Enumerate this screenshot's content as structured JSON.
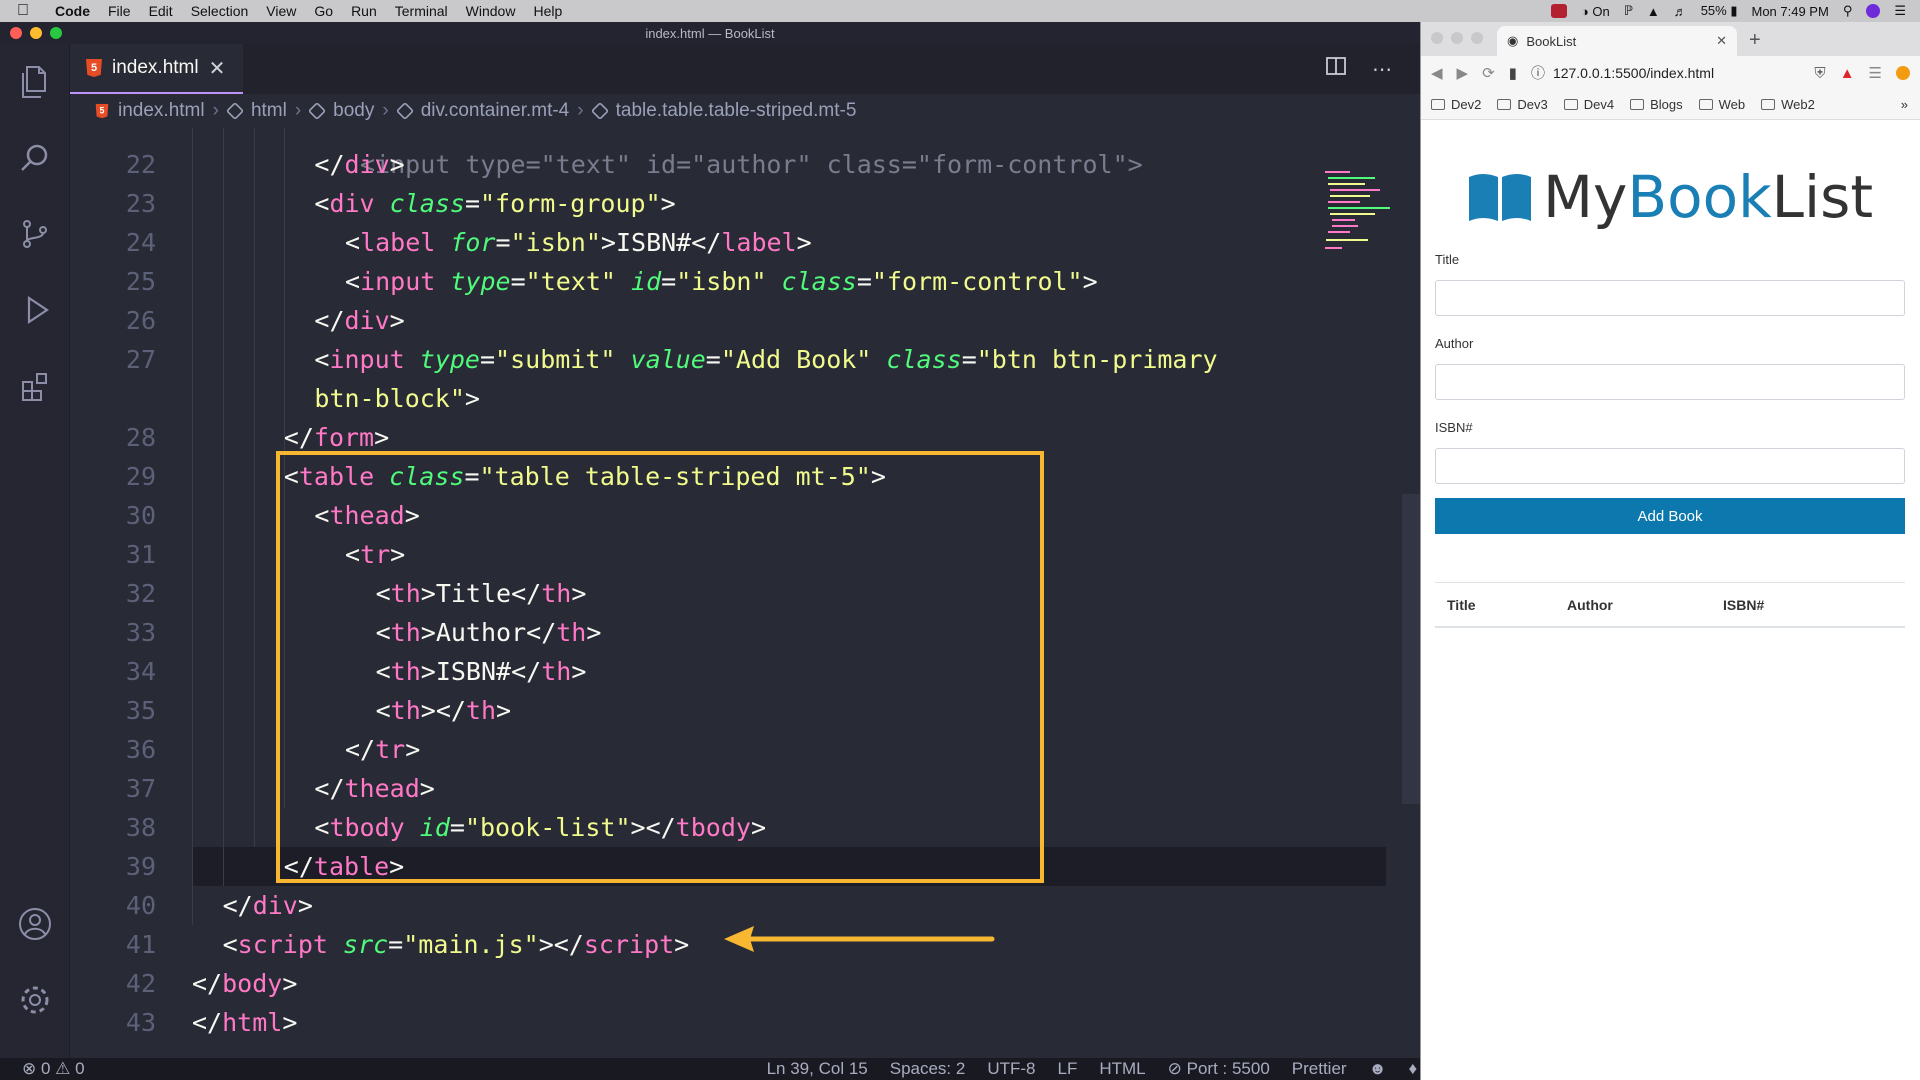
{
  "menubar": {
    "items": [
      "Code",
      "File",
      "Edit",
      "Selection",
      "View",
      "Go",
      "Run",
      "Terminal",
      "Window",
      "Help"
    ],
    "right": {
      "focus": "On",
      "battery": "55%",
      "clock": "Mon 7:49 PM"
    }
  },
  "vscode": {
    "window_title": "index.html — BookList",
    "tab": {
      "label": "index.html"
    },
    "breadcrumb": [
      "index.html",
      "html",
      "body",
      "div.container.mt-4",
      "table.table.table-striped.mt-5"
    ],
    "status": {
      "errors": "0",
      "warnings": "0",
      "position": "Ln 39, Col 15",
      "spaces": "Spaces: 2",
      "encoding": "UTF-8",
      "eol": "LF",
      "language": "HTML",
      "port": "Port : 5500",
      "formatter": "Prettier"
    },
    "code": {
      "partial_top": "<input type=\"text\" id=\"author\" class=\"form-control\">",
      "lines": [
        {
          "n": "22",
          "tokens": [
            [
              "punc",
              "</"
            ],
            [
              "tag",
              "div"
            ],
            [
              "punc",
              ">"
            ]
          ]
        },
        {
          "n": "23",
          "tokens": [
            [
              "punc",
              "<"
            ],
            [
              "tag",
              "div "
            ],
            [
              "attr",
              "class"
            ],
            [
              "punc",
              "="
            ],
            [
              "str",
              "\"form-group\""
            ],
            [
              "punc",
              ">"
            ]
          ]
        },
        {
          "n": "24",
          "tokens": [
            [
              "punc",
              "<"
            ],
            [
              "tag",
              "label "
            ],
            [
              "attr",
              "for"
            ],
            [
              "punc",
              "="
            ],
            [
              "str",
              "\"isbn\""
            ],
            [
              "punc",
              ">"
            ],
            [
              "txt",
              "ISBN#"
            ],
            [
              "punc",
              "</"
            ],
            [
              "tag",
              "label"
            ],
            [
              "punc",
              ">"
            ]
          ]
        },
        {
          "n": "25",
          "tokens": [
            [
              "punc",
              "<"
            ],
            [
              "tag",
              "input "
            ],
            [
              "attr",
              "type"
            ],
            [
              "punc",
              "="
            ],
            [
              "str",
              "\"text\" "
            ],
            [
              "attr",
              "id"
            ],
            [
              "punc",
              "="
            ],
            [
              "str",
              "\"isbn\" "
            ],
            [
              "attr",
              "class"
            ],
            [
              "punc",
              "="
            ],
            [
              "str",
              "\"form-control\""
            ],
            [
              "punc",
              ">"
            ]
          ]
        },
        {
          "n": "26",
          "tokens": [
            [
              "punc",
              "</"
            ],
            [
              "tag",
              "div"
            ],
            [
              "punc",
              ">"
            ]
          ]
        },
        {
          "n": "27",
          "tokens": [
            [
              "punc",
              "<"
            ],
            [
              "tag",
              "input "
            ],
            [
              "attr",
              "type"
            ],
            [
              "punc",
              "="
            ],
            [
              "str",
              "\"submit\" "
            ],
            [
              "attr",
              "value"
            ],
            [
              "punc",
              "="
            ],
            [
              "str",
              "\"Add Book\" "
            ],
            [
              "attr",
              "class"
            ],
            [
              "punc",
              "="
            ],
            [
              "str",
              "\"btn btn-primary"
            ]
          ]
        },
        {
          "n": "",
          "tokens": [
            [
              "str",
              "btn-block\""
            ],
            [
              "punc",
              ">"
            ]
          ]
        },
        {
          "n": "28",
          "tokens": [
            [
              "punc",
              "</"
            ],
            [
              "tag",
              "form"
            ],
            [
              "punc",
              ">"
            ]
          ]
        },
        {
          "n": "29",
          "tokens": [
            [
              "punc",
              "<"
            ],
            [
              "tag",
              "table "
            ],
            [
              "attr",
              "class"
            ],
            [
              "punc",
              "="
            ],
            [
              "str",
              "\"table table-striped mt-5\""
            ],
            [
              "punc",
              ">"
            ]
          ]
        },
        {
          "n": "30",
          "tokens": [
            [
              "punc",
              "<"
            ],
            [
              "tag",
              "thead"
            ],
            [
              "punc",
              ">"
            ]
          ]
        },
        {
          "n": "31",
          "tokens": [
            [
              "punc",
              "<"
            ],
            [
              "tag",
              "tr"
            ],
            [
              "punc",
              ">"
            ]
          ]
        },
        {
          "n": "32",
          "tokens": [
            [
              "punc",
              "<"
            ],
            [
              "tag",
              "th"
            ],
            [
              "punc",
              ">"
            ],
            [
              "txt",
              "Title"
            ],
            [
              "punc",
              "</"
            ],
            [
              "tag",
              "th"
            ],
            [
              "punc",
              ">"
            ]
          ]
        },
        {
          "n": "33",
          "tokens": [
            [
              "punc",
              "<"
            ],
            [
              "tag",
              "th"
            ],
            [
              "punc",
              ">"
            ],
            [
              "txt",
              "Author"
            ],
            [
              "punc",
              "</"
            ],
            [
              "tag",
              "th"
            ],
            [
              "punc",
              ">"
            ]
          ]
        },
        {
          "n": "34",
          "tokens": [
            [
              "punc",
              "<"
            ],
            [
              "tag",
              "th"
            ],
            [
              "punc",
              ">"
            ],
            [
              "txt",
              "ISBN#"
            ],
            [
              "punc",
              "</"
            ],
            [
              "tag",
              "th"
            ],
            [
              "punc",
              ">"
            ]
          ]
        },
        {
          "n": "35",
          "tokens": [
            [
              "punc",
              "<"
            ],
            [
              "tag",
              "th"
            ],
            [
              "punc",
              "></"
            ],
            [
              "tag",
              "th"
            ],
            [
              "punc",
              ">"
            ]
          ]
        },
        {
          "n": "36",
          "tokens": [
            [
              "punc",
              "</"
            ],
            [
              "tag",
              "tr"
            ],
            [
              "punc",
              ">"
            ]
          ]
        },
        {
          "n": "37",
          "tokens": [
            [
              "punc",
              "</"
            ],
            [
              "tag",
              "thead"
            ],
            [
              "punc",
              ">"
            ]
          ]
        },
        {
          "n": "38",
          "tokens": [
            [
              "punc",
              "<"
            ],
            [
              "tag",
              "tbody "
            ],
            [
              "attr",
              "id"
            ],
            [
              "punc",
              "="
            ],
            [
              "str",
              "\"book-list\""
            ],
            [
              "punc",
              "></"
            ],
            [
              "tag",
              "tbody"
            ],
            [
              "punc",
              ">"
            ]
          ]
        },
        {
          "n": "39",
          "tokens": [
            [
              "punc",
              "</"
            ],
            [
              "tag",
              "table"
            ],
            [
              "punc",
              ">"
            ]
          ]
        },
        {
          "n": "40",
          "tokens": [
            [
              "punc",
              "</"
            ],
            [
              "tag",
              "div"
            ],
            [
              "punc",
              ">"
            ]
          ]
        },
        {
          "n": "41",
          "tokens": [
            [
              "punc",
              "<"
            ],
            [
              "tag",
              "script "
            ],
            [
              "attr",
              "src"
            ],
            [
              "punc",
              "="
            ],
            [
              "str",
              "\"main.js\""
            ],
            [
              "punc",
              "></"
            ],
            [
              "tag",
              "script"
            ],
            [
              "punc",
              ">"
            ]
          ]
        },
        {
          "n": "42",
          "tokens": [
            [
              "punc",
              "</"
            ],
            [
              "tag",
              "body"
            ],
            [
              "punc",
              ">"
            ]
          ]
        },
        {
          "n": "43",
          "tokens": [
            [
              "punc",
              "</"
            ],
            [
              "tag",
              "html"
            ],
            [
              "punc",
              ">"
            ]
          ]
        }
      ]
    }
  },
  "browser": {
    "tab_title": "BookList",
    "url": "127.0.0.1:5500/index.html",
    "bookmarks": [
      "Dev2",
      "Dev3",
      "Dev4",
      "Blogs",
      "Web",
      "Web2"
    ],
    "logo": {
      "part1": "My",
      "part2": "Book",
      "part3": "List"
    },
    "form": {
      "title_label": "Title",
      "author_label": "Author",
      "isbn_label": "ISBN#",
      "submit_label": "Add Book"
    },
    "table_headers": [
      "Title",
      "Author",
      "ISBN#"
    ]
  },
  "colors": {
    "accent": "#f7b731",
    "tag": "#ff79c6",
    "attr": "#50fa7b",
    "string": "#f1fa8c",
    "button": "#0d78ad"
  }
}
